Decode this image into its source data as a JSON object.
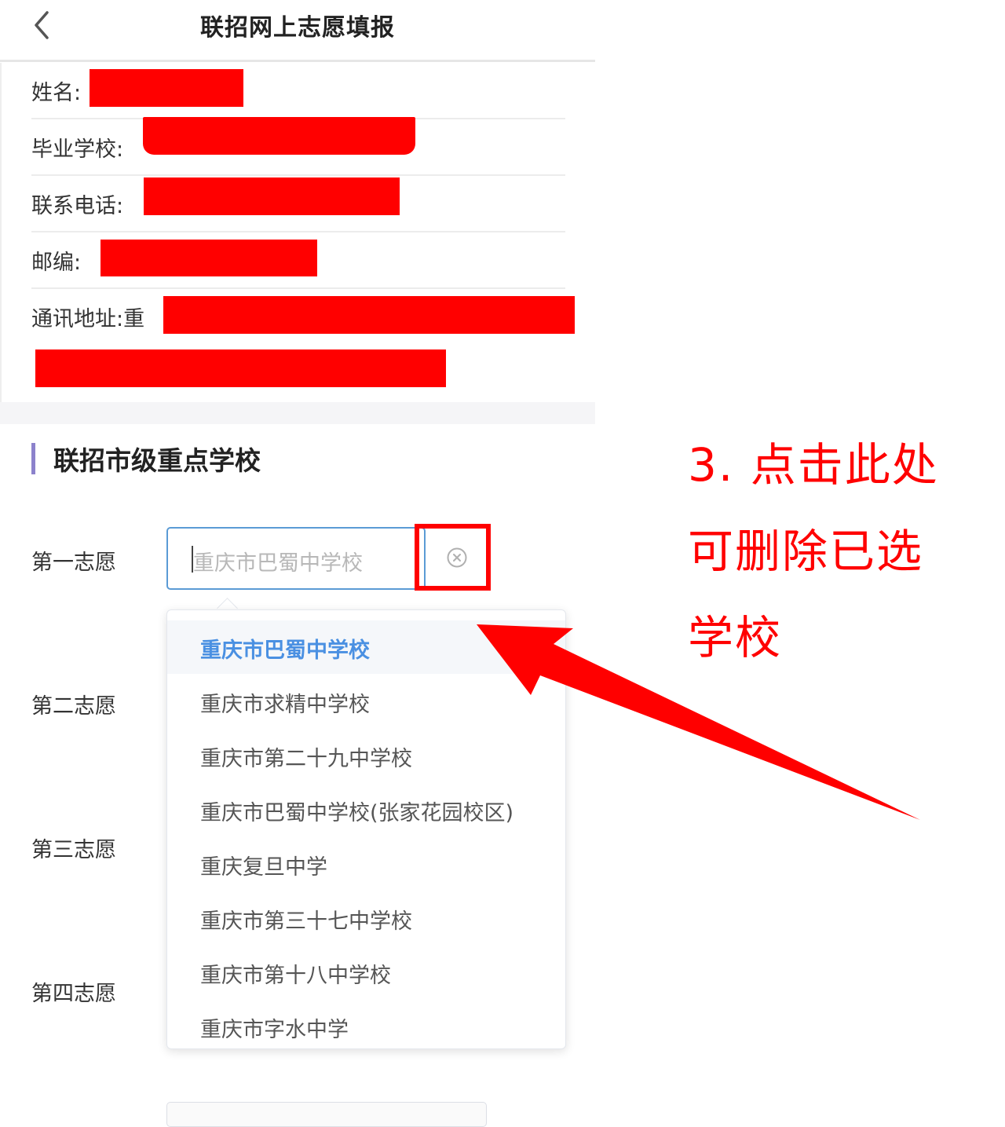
{
  "header": {
    "title": "联招网上志愿填报"
  },
  "info": {
    "name_label": "姓名:",
    "school_label": "毕业学校:",
    "phone_label": "联系电话:",
    "zip_label": "邮编:",
    "address_label": "通讯地址:重"
  },
  "section": {
    "title": "联招市级重点学校"
  },
  "choices": {
    "first": "第一志愿",
    "second": "第二志愿",
    "third": "第三志愿",
    "fourth": "第四志愿"
  },
  "select": {
    "placeholder": "重庆市巴蜀中学校"
  },
  "dropdown": {
    "options": [
      "重庆市巴蜀中学校",
      "重庆市求精中学校",
      "重庆市第二十九中学校",
      "重庆市巴蜀中学校(张家花园校区)",
      "重庆复旦中学",
      "重庆市第三十七中学校",
      "重庆市第十八中学校",
      "重庆市字水中学"
    ],
    "selected_index": 0
  },
  "annotation": {
    "line1": "3. 点击此处",
    "line2": "可删除已选",
    "line3": "学校",
    "color": "#ff0000"
  },
  "colors": {
    "accent": "#4a90e2",
    "section_bar": "#8c82cc",
    "redaction": "#ff0000"
  }
}
